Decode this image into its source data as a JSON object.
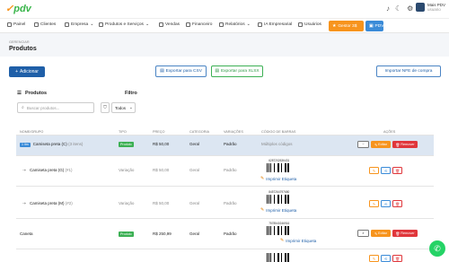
{
  "header": {
    "logo": "pdv",
    "user_name": "Mais PDV",
    "user_sub": "usuario"
  },
  "nav": {
    "items": [
      {
        "label": "Painel"
      },
      {
        "label": "Clientes"
      },
      {
        "label": "Empresa"
      },
      {
        "label": "Produtos e Serviços"
      },
      {
        "label": "Vendas"
      },
      {
        "label": "Financeiro"
      },
      {
        "label": "Relatórios"
      },
      {
        "label": "IA Empresarial"
      },
      {
        "label": "Usuários"
      }
    ],
    "gestor_label": "Gestor 3$",
    "pdv_label": "PDV"
  },
  "page": {
    "breadcrumb": "GERENCIAR",
    "title": "Produtos"
  },
  "toolbar": {
    "add_label": "Adicionar",
    "export_csv": "Exportar para CSV",
    "export_xls": "Exportar para XLSX",
    "import_nfe": "Importar NFE de compra"
  },
  "list": {
    "title": "Produtos",
    "filter_title": "Filtro",
    "search_placeholder": "Buscar produtos...",
    "filter_value": "Todos"
  },
  "table": {
    "headers": [
      "NOME/GRUPO",
      "TIPO",
      "PREÇO",
      "CATEGORIA",
      "VARIAÇÕES",
      "CÓDIGO DE BARRAS",
      "AÇÕES"
    ],
    "rows": [
      {
        "name": "Camiseta preta (C)",
        "extra": "(3 itens)",
        "tag": "1 itm",
        "type": "Produto",
        "price": "R$ 50,00",
        "category": "Geral",
        "variations": "Padrão",
        "barcode_text": "Múltiplos códigos",
        "edit": "Editar",
        "delete": "Remover"
      },
      {
        "name": "Camiseta preta (G)",
        "extra": "(#1)",
        "type": "Variação",
        "price": "R$ 50,00",
        "category": "Geral",
        "variations": "Padrão",
        "barcode": "6287202636431",
        "print": "Imprimir Etiqueta"
      },
      {
        "name": "Camiseta preta (M)",
        "extra": "(#2)",
        "type": "Variação",
        "price": "R$ 50,00",
        "category": "Geral",
        "variations": "Padrão",
        "barcode": "8457264797680",
        "print": "Imprimir Etiqueta"
      },
      {
        "name": "Caneta",
        "type": "Produto",
        "price": "R$ 250,99",
        "category": "Geral",
        "variations": "Padrão",
        "barcode": "7578540246916",
        "print": "Imprimir Etiqueta",
        "edit": "Editar",
        "delete": "Remover"
      }
    ]
  }
}
